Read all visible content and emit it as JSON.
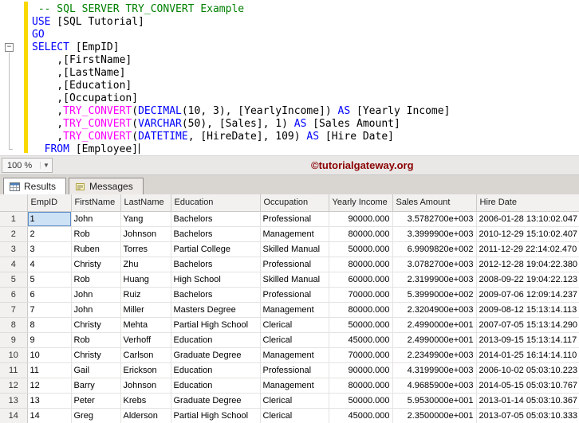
{
  "colors": {
    "keyword": "#0000ff",
    "comment": "#008000",
    "function": "#ff00ff",
    "track_changes": "#f8d800",
    "watermark": "#8b0000",
    "selection_fill": "#cde2f5",
    "selection_border": "#5b8cc9"
  },
  "editor": {
    "lines": [
      [
        {
          "s": "p",
          "t": " "
        },
        {
          "s": "c",
          "t": "-- SQL SERVER TRY_CONVERT Example"
        }
      ],
      [
        {
          "s": "k",
          "t": "USE"
        },
        {
          "s": "p",
          "t": " [SQL Tutorial]"
        }
      ],
      [
        {
          "s": "k",
          "t": "GO"
        }
      ],
      [
        {
          "s": "k",
          "t": "SELECT"
        },
        {
          "s": "p",
          "t": " [EmpID]"
        }
      ],
      [
        {
          "s": "p",
          "t": "    ,[FirstName]"
        }
      ],
      [
        {
          "s": "p",
          "t": "    ,[LastName]"
        }
      ],
      [
        {
          "s": "p",
          "t": "    ,[Education]"
        }
      ],
      [
        {
          "s": "p",
          "t": "    ,[Occupation]"
        }
      ],
      [
        {
          "s": "p",
          "t": "    ,"
        },
        {
          "s": "f",
          "t": "TRY_CONVERT"
        },
        {
          "s": "p",
          "t": "("
        },
        {
          "s": "k",
          "t": "DECIMAL"
        },
        {
          "s": "p",
          "t": "(10, 3), [YearlyIncome]) "
        },
        {
          "s": "k",
          "t": "AS"
        },
        {
          "s": "p",
          "t": " [Yearly Income]"
        }
      ],
      [
        {
          "s": "p",
          "t": "    ,"
        },
        {
          "s": "f",
          "t": "TRY_CONVERT"
        },
        {
          "s": "p",
          "t": "("
        },
        {
          "s": "k",
          "t": "VARCHAR"
        },
        {
          "s": "p",
          "t": "(50), [Sales], 1) "
        },
        {
          "s": "k",
          "t": "AS"
        },
        {
          "s": "p",
          "t": " [Sales Amount]"
        }
      ],
      [
        {
          "s": "p",
          "t": "    ,"
        },
        {
          "s": "f",
          "t": "TRY_CONVERT"
        },
        {
          "s": "p",
          "t": "("
        },
        {
          "s": "k",
          "t": "DATETIME"
        },
        {
          "s": "p",
          "t": ", [HireDate], 109) "
        },
        {
          "s": "k",
          "t": "AS"
        },
        {
          "s": "p",
          "t": " [Hire Date]"
        }
      ],
      [
        {
          "s": "p",
          "t": "  "
        },
        {
          "s": "k",
          "t": "FROM"
        },
        {
          "s": "p",
          "t": " [Employee]"
        }
      ]
    ]
  },
  "statusbar": {
    "zoom": "100 %",
    "watermark": "©tutorialgateway.org"
  },
  "tabs": {
    "results": "Results",
    "messages": "Messages"
  },
  "grid": {
    "columns": [
      "EmpID",
      "FirstName",
      "LastName",
      "Education",
      "Occupation",
      "Yearly Income",
      "Sales Amount",
      "Hire Date"
    ],
    "selected_cell": {
      "row": 1,
      "column": "EmpID"
    },
    "rows": [
      {
        "n": "1",
        "cells": [
          "1",
          "John",
          "Yang",
          "Bachelors",
          "Professional",
          "90000.000",
          "3.5782700e+003",
          "2006-01-28 13:10:02.047"
        ]
      },
      {
        "n": "2",
        "cells": [
          "2",
          "Rob",
          "Johnson",
          "Bachelors",
          "Management",
          "80000.000",
          "3.3999900e+003",
          "2010-12-29 15:10:02.407"
        ]
      },
      {
        "n": "3",
        "cells": [
          "3",
          "Ruben",
          "Torres",
          "Partial College",
          "Skilled Manual",
          "50000.000",
          "6.9909820e+002",
          "2011-12-29 22:14:02.470"
        ]
      },
      {
        "n": "4",
        "cells": [
          "4",
          "Christy",
          "Zhu",
          "Bachelors",
          "Professional",
          "80000.000",
          "3.0782700e+003",
          "2012-12-28 19:04:22.380"
        ]
      },
      {
        "n": "5",
        "cells": [
          "5",
          "Rob",
          "Huang",
          "High School",
          "Skilled Manual",
          "60000.000",
          "2.3199900e+003",
          "2008-09-22 19:04:22.123"
        ]
      },
      {
        "n": "6",
        "cells": [
          "6",
          "John",
          "Ruiz",
          "Bachelors",
          "Professional",
          "70000.000",
          "5.3999000e+002",
          "2009-07-06 12:09:14.237"
        ]
      },
      {
        "n": "7",
        "cells": [
          "7",
          "John",
          "Miller",
          "Masters Degree",
          "Management",
          "80000.000",
          "2.3204900e+003",
          "2009-08-12 15:13:14.113"
        ]
      },
      {
        "n": "8",
        "cells": [
          "8",
          "Christy",
          "Mehta",
          "Partial High School",
          "Clerical",
          "50000.000",
          "2.4990000e+001",
          "2007-07-05 15:13:14.290"
        ]
      },
      {
        "n": "9",
        "cells": [
          "9",
          "Rob",
          "Verhoff",
          "Education",
          "Clerical",
          "45000.000",
          "2.4990000e+001",
          "2013-09-15 15:13:14.117"
        ]
      },
      {
        "n": "10",
        "cells": [
          "10",
          "Christy",
          "Carlson",
          "Graduate Degree",
          "Management",
          "70000.000",
          "2.2349900e+003",
          "2014-01-25 16:14:14.110"
        ]
      },
      {
        "n": "11",
        "cells": [
          "11",
          "Gail",
          "Erickson",
          "Education",
          "Professional",
          "90000.000",
          "4.3199900e+003",
          "2006-10-02 05:03:10.223"
        ]
      },
      {
        "n": "12",
        "cells": [
          "12",
          "Barry",
          "Johnson",
          "Education",
          "Management",
          "80000.000",
          "4.9685900e+003",
          "2014-05-15 05:03:10.767"
        ]
      },
      {
        "n": "13",
        "cells": [
          "13",
          "Peter",
          "Krebs",
          "Graduate Degree",
          "Clerical",
          "50000.000",
          "5.9530000e+001",
          "2013-01-14 05:03:10.367"
        ]
      },
      {
        "n": "14",
        "cells": [
          "14",
          "Greg",
          "Alderson",
          "Partial High School",
          "Clerical",
          "45000.000",
          "2.3500000e+001",
          "2013-07-05 05:03:10.333"
        ]
      }
    ]
  }
}
